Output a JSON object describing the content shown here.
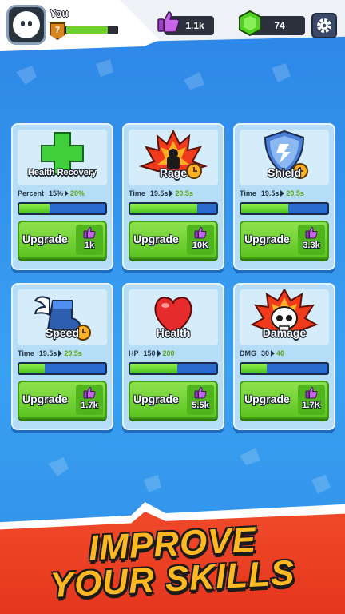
{
  "player": {
    "name": "You",
    "level": "7",
    "xp_fraction": 0.82
  },
  "currencies": {
    "likes": "1.1k",
    "gems": "74"
  },
  "skills": [
    {
      "title": "Health Recovery",
      "stat_label": "Percent",
      "current": "15%",
      "next": "20%",
      "progress": 0.35,
      "upgrade_label": "Upgrade",
      "cost": "1k"
    },
    {
      "title": "Rage",
      "stat_label": "Time",
      "current": "19.5s",
      "next": "20.5s",
      "progress": 0.78,
      "upgrade_label": "Upgrade",
      "cost": "10K"
    },
    {
      "title": "Shield",
      "stat_label": "Time",
      "current": "19.5s",
      "next": "20.5s",
      "progress": 0.55,
      "upgrade_label": "Upgrade",
      "cost": "3.3k"
    },
    {
      "title": "Speed",
      "stat_label": "Time",
      "current": "19.5s",
      "next": "20.5s",
      "progress": 0.3,
      "upgrade_label": "Upgrade",
      "cost": "1.7k"
    },
    {
      "title": "Health",
      "stat_label": "HP",
      "current": "150",
      "next": "200",
      "progress": 0.55,
      "upgrade_label": "Upgrade",
      "cost": "5.5k"
    },
    {
      "title": "Damage",
      "stat_label": "DMG",
      "current": "30",
      "next": "40",
      "progress": 0.3,
      "upgrade_label": "Upgrade",
      "cost": "1.7K"
    }
  ],
  "promo": {
    "line1": "IMPROVE",
    "line2": "YOUR SKILLS"
  },
  "icons": {
    "avatar": "ghost-avatar-icon",
    "likes": "thumbs-up-icon",
    "gems": "green-gem-icon",
    "settings": "gear-icon",
    "skills": [
      "green-cross-icon",
      "rage-fire-icon",
      "shield-icon",
      "winged-boot-icon",
      "heart-icon",
      "skull-fire-icon"
    ]
  },
  "colors": {
    "accent_green": "#5cc421",
    "bar_blue": "#2a6bcf",
    "banner_red": "#e5361d",
    "promo_gold": "#ffb821",
    "like_purple": "#b44fd8"
  }
}
